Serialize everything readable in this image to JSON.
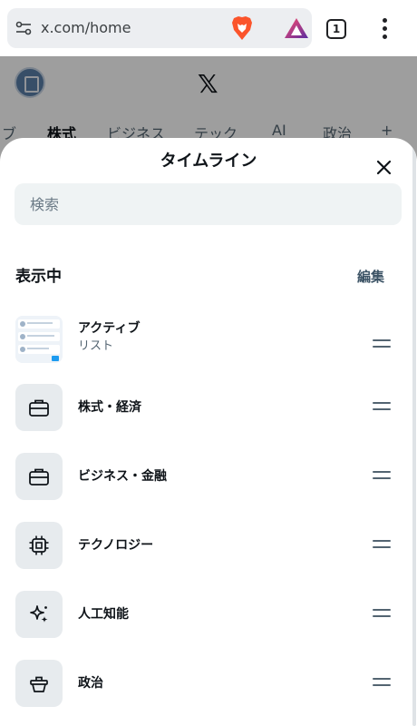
{
  "browser": {
    "url": "x.com/home",
    "tab_count": "1"
  },
  "background": {
    "logo": "𝕏",
    "tabs": [
      "ブ",
      "株式",
      "ビジネス",
      "テック",
      "AI",
      "政治",
      "+"
    ]
  },
  "sheet": {
    "title": "タイムライン",
    "search_placeholder": "検索",
    "section_title": "表示中",
    "edit_label": "編集",
    "items": [
      {
        "label": "アクティブ",
        "sublabel": "リスト",
        "icon": "list-thumbnail-icon"
      },
      {
        "label": "株式・経済",
        "icon": "briefcase-icon"
      },
      {
        "label": "ビジネス・金融",
        "icon": "briefcase-icon"
      },
      {
        "label": "テクノロジー",
        "icon": "chip-icon"
      },
      {
        "label": "人工知能",
        "icon": "sparkle-icon"
      },
      {
        "label": "政治",
        "icon": "podium-icon"
      }
    ]
  },
  "colors": {
    "brave_orange": "#fb542b",
    "accent_text": "#3d5466",
    "icon_bg": "#e7ebee"
  }
}
